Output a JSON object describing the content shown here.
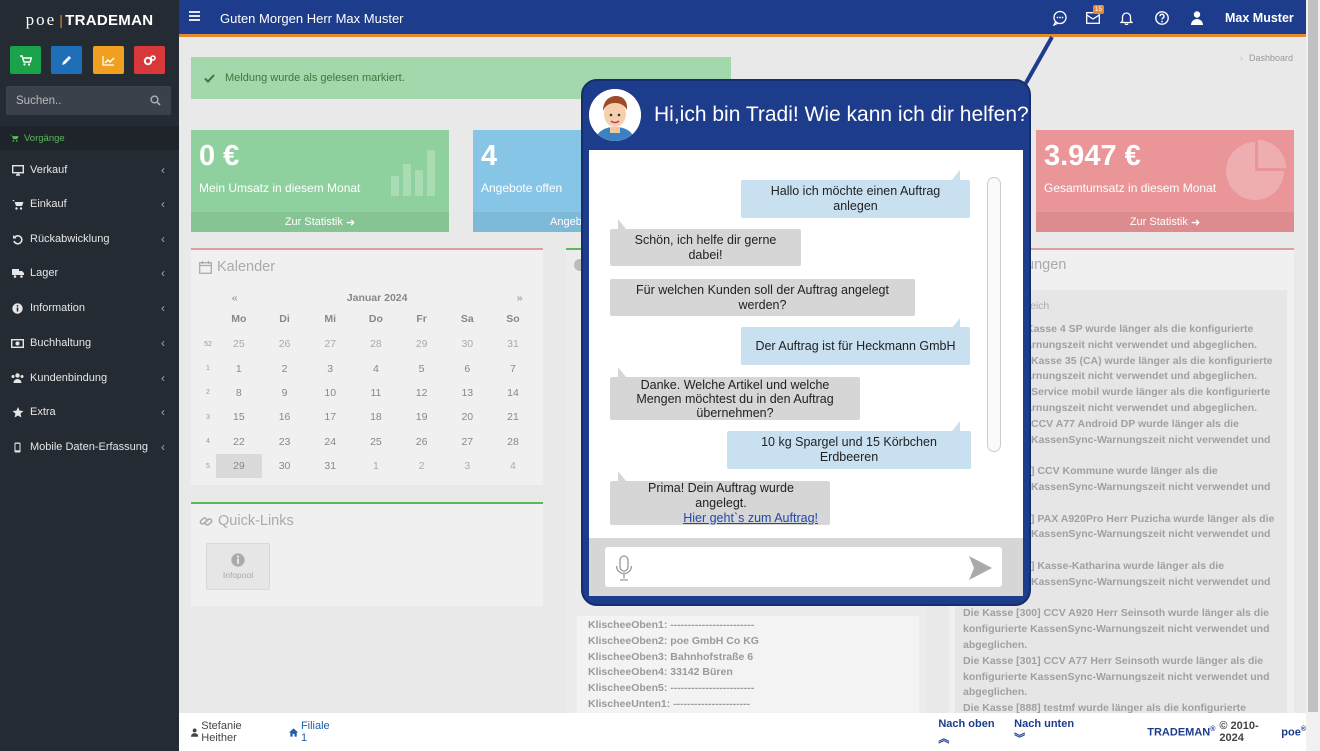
{
  "brand": {
    "prefix": "poe",
    "name": "TRADEMAN"
  },
  "quick_buttons": [
    {
      "name": "cart",
      "color": "#1aa34a"
    },
    {
      "name": "pencil",
      "color": "#1f6fb8"
    },
    {
      "name": "chart",
      "color": "#f0a01e"
    },
    {
      "name": "gears",
      "color": "#d9383a"
    }
  ],
  "search": {
    "placeholder": "Suchen.."
  },
  "sidebar": {
    "section": "Vorgänge",
    "items": [
      {
        "label": "Verkauf",
        "icon": "monitor-icon"
      },
      {
        "label": "Einkauf",
        "icon": "cart-icon"
      },
      {
        "label": "Rückabwicklung",
        "icon": "undo-icon"
      },
      {
        "label": "Lager",
        "icon": "truck-icon"
      },
      {
        "label": "Information",
        "icon": "info-icon"
      },
      {
        "label": "Buchhaltung",
        "icon": "money-icon"
      },
      {
        "label": "Kundenbindung",
        "icon": "users-icon"
      },
      {
        "label": "Extra",
        "icon": "star-icon"
      },
      {
        "label": "Mobile Daten-Erfassung",
        "icon": "mobile-icon"
      }
    ]
  },
  "header": {
    "greeting": "Guten Morgen Herr Max Muster",
    "mail_count": "15",
    "user": "Max Muster"
  },
  "alert": {
    "text": "Meldung wurde als gelesen markiert."
  },
  "breadcrumb": "Dashboard",
  "tiles": [
    {
      "value": "0 €",
      "label": "Mein Umsatz in diesem Monat",
      "link": "Zur Statistik",
      "color": "#8fd19e"
    },
    {
      "value": "4",
      "label": "Angebote offen",
      "link": "Angeb",
      "color": "#86c5e6"
    },
    {
      "value": "3.947 €",
      "label": "Gesamtumsatz in diesem Monat",
      "link": "Zur Statistik",
      "color": "#ea9598"
    }
  ],
  "calendar": {
    "title": "Kalender",
    "prev": "«",
    "next": "»",
    "month": "Januar 2024",
    "weekdays": [
      "Mo",
      "Di",
      "Mi",
      "Do",
      "Fr",
      "Sa",
      "So"
    ],
    "weeks": [
      {
        "no": "52",
        "days": [
          "25",
          "26",
          "27",
          "28",
          "29",
          "30",
          "31"
        ]
      },
      {
        "no": "1",
        "days": [
          "1",
          "2",
          "3",
          "4",
          "5",
          "6",
          "7"
        ]
      },
      {
        "no": "2",
        "days": [
          "8",
          "9",
          "10",
          "11",
          "12",
          "13",
          "14"
        ]
      },
      {
        "no": "3",
        "days": [
          "15",
          "16",
          "17",
          "18",
          "19",
          "20",
          "21"
        ]
      },
      {
        "no": "4",
        "days": [
          "22",
          "23",
          "24",
          "25",
          "26",
          "27",
          "28"
        ]
      },
      {
        "no": "5",
        "days": [
          "29",
          "30",
          "31",
          "1",
          "2",
          "3",
          "4"
        ]
      }
    ],
    "today": "29"
  },
  "quicklinks": {
    "title": "Quick-Links",
    "items": [
      {
        "label": "Infopool"
      }
    ]
  },
  "klischee": [
    "KlischeeOben1: ------------------------",
    "KlischeeOben2: poe GmbH Co KG",
    "KlischeeOben3: Bahnhofstraße 6",
    "KlischeeOben4: 33142 Büren",
    "KlischeeOben5: ------------------------",
    "KlischeeUnten1: ----------------------"
  ],
  "warnings": {
    "title": "ungen",
    "subtitle": "eich",
    "lines": [
      "Kasse 4 SP wurde länger als die konfigurierte",
      "arnungszeit nicht verwendet und abgeglichen.",
      "Kasse 35 (CA) wurde länger als die konfigurierte",
      "arnungszeit nicht verwendet und abgeglichen.",
      "Service mobil wurde länger als die konfigurierte",
      "arnungszeit nicht verwendet und abgeglichen.",
      "CCV A77 Android DP wurde länger als die",
      "KassenSync-Warnungszeit nicht verwendet und",
      "",
      "] CCV Kommune wurde länger als die",
      "KassenSync-Warnungszeit nicht verwendet und",
      "",
      "] PAX A920Pro Herr Puzicha wurde länger als die",
      "KassenSync-Warnungszeit nicht verwendet und",
      "",
      "] Kasse-Katharina wurde länger als die",
      "KassenSync-Warnungszeit nicht verwendet und",
      "",
      "Die Kasse [300] CCV A920 Herr Seinsoth wurde länger als die",
      "konfigurierte KassenSync-Warnungszeit nicht verwendet und",
      "abgeglichen.",
      "Die Kasse [301] CCV A77 Herr Seinsoth wurde länger als die",
      "konfigurierte KassenSync-Warnungszeit nicht verwendet und",
      "abgeglichen.",
      "Die Kasse [888] testmf wurde länger als die konfigurierte"
    ]
  },
  "footer": {
    "user": "Stefanie Heither",
    "branch": "Filiale 1",
    "top": "Nach oben",
    "bottom": "Nach unten",
    "brand": "TRADEMAN",
    "copyright": "© 2010-2024",
    "company": "poe"
  },
  "chat": {
    "title": "Hi,ich bin Tradi! Wie kann ich dir helfen?",
    "messages": [
      {
        "from": "user",
        "text": "Hallo ich möchte einen Auftrag anlegen"
      },
      {
        "from": "bot",
        "text": "Schön, ich helfe dir gerne dabei!"
      },
      {
        "from": "bot",
        "text": "Für welchen Kunden soll der Auftrag angelegt werden?"
      },
      {
        "from": "user",
        "text": "Der Auftrag ist für Heckmann GmbH"
      },
      {
        "from": "bot",
        "text": "Danke. Welche Artikel und welche Mengen möchtest du in den Auftrag übernehmen?"
      },
      {
        "from": "user",
        "text": "10 kg Spargel und 15 Körbchen Erdbeeren"
      },
      {
        "from": "bot",
        "text": "Prima! Dein Auftrag wurde angelegt.",
        "link": "Hier geht`s  zum Auftrag!"
      }
    ]
  }
}
